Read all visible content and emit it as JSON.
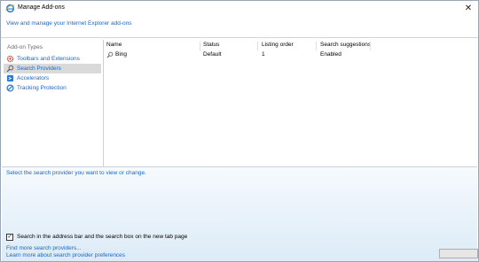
{
  "window": {
    "title": "Manage Add-ons",
    "close_glyph": "✕",
    "header_link": "View and manage your Internet Explorer add-ons"
  },
  "sidebar": {
    "heading": "Add-on Types",
    "items": [
      {
        "label": "Toolbars and Extensions",
        "icon": "gear-icon",
        "selected": false
      },
      {
        "label": "Search Providers",
        "icon": "search-icon",
        "selected": true
      },
      {
        "label": "Accelerators",
        "icon": "accelerator-icon",
        "selected": false
      },
      {
        "label": "Tracking Protection",
        "icon": "tracking-protection-icon",
        "selected": false
      }
    ]
  },
  "list": {
    "columns": [
      "Name",
      "Status",
      "Listing order",
      "Search suggestions"
    ],
    "rows": [
      {
        "name": "Bing",
        "status": "Default",
        "listing_order": "1",
        "search_suggestions": "Enabled"
      }
    ]
  },
  "details": {
    "hint": "Select the search provider you want to view or change.",
    "checkbox_label": "Search in the address bar and the search box on the new tab page",
    "checkbox_checked": true,
    "checkbox_glyph": "✓",
    "links": [
      "Find more search providers...",
      "Learn more about search provider preferences"
    ]
  },
  "colors": {
    "link": "#1a66c7",
    "selected_bg": "#d9d9d9",
    "details_gradient_top": "#f6fafd",
    "details_gradient_bottom": "#dcebf6"
  }
}
